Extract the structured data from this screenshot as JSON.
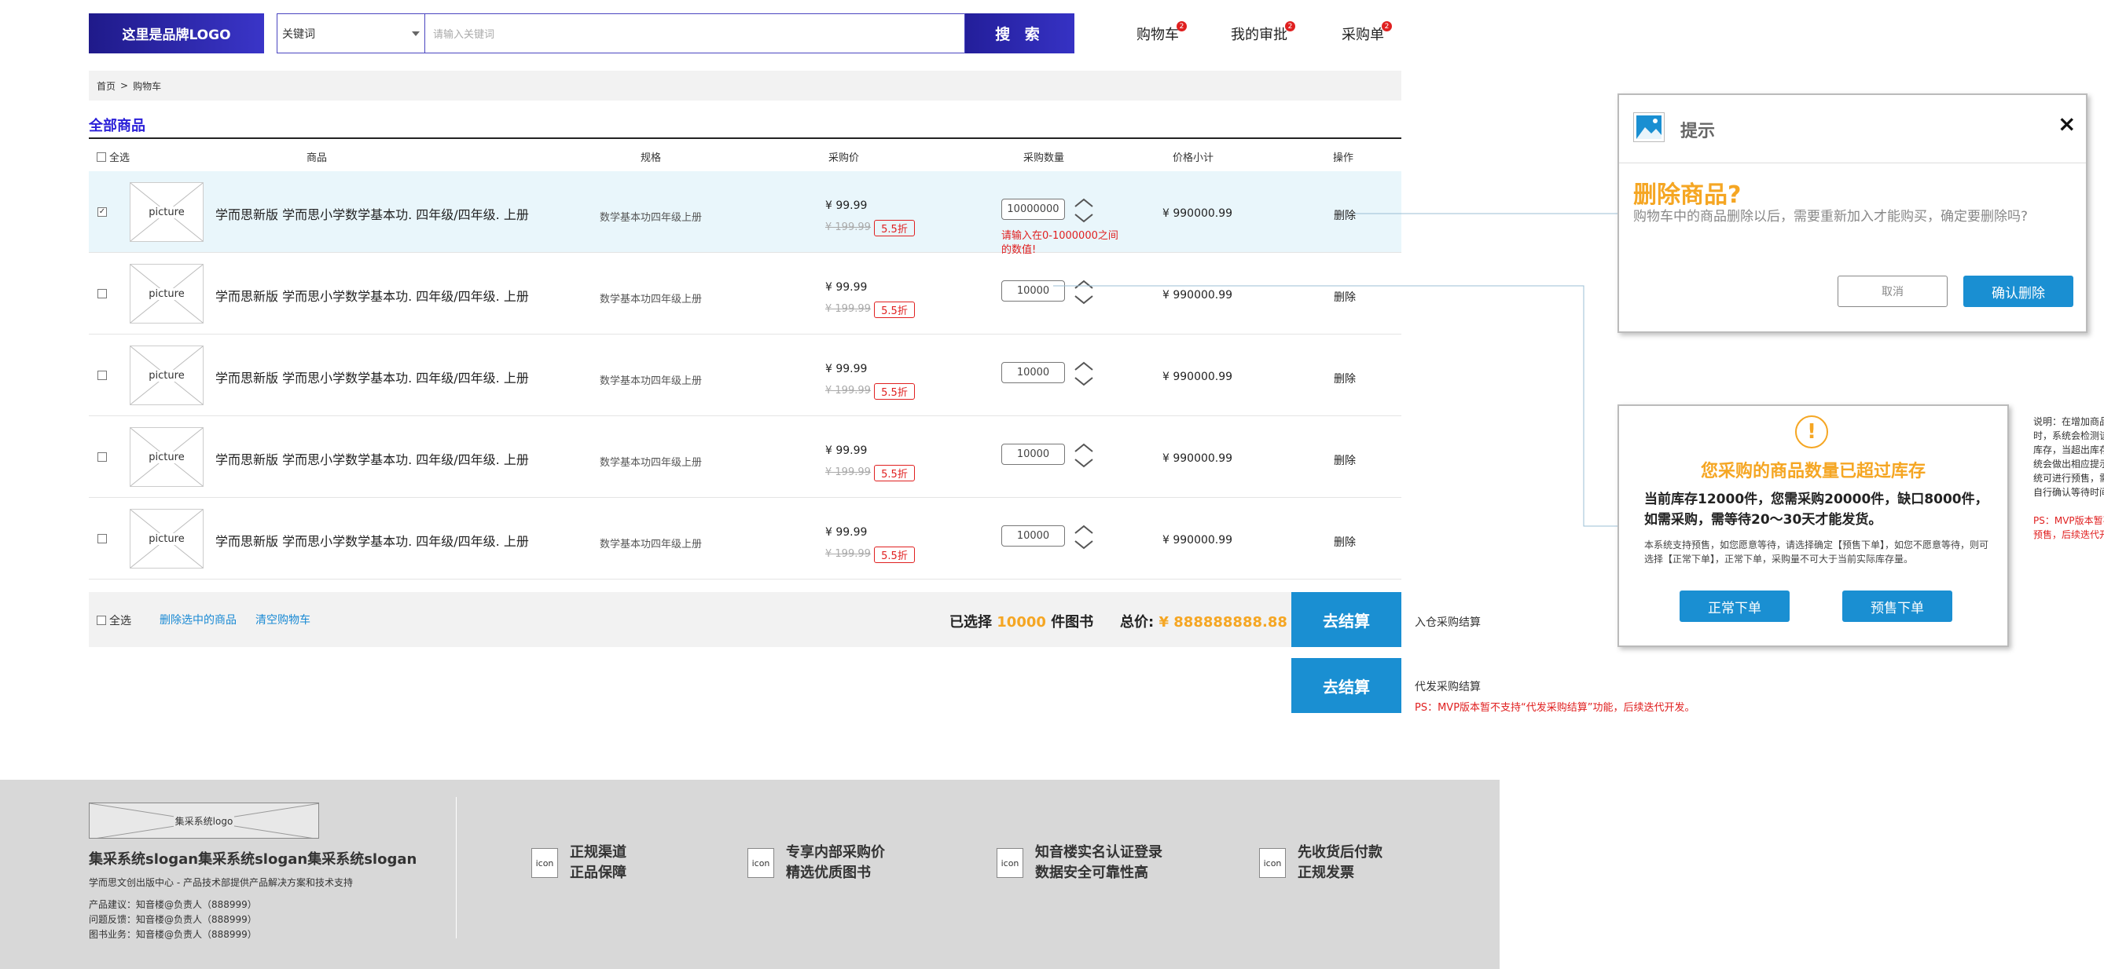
{
  "header": {
    "logo": "这里是品牌LOGO",
    "search_select": "关键词",
    "search_placeholder": "请输入关键词",
    "search_button": "搜 索",
    "nav": [
      {
        "label": "购物车",
        "badge": "2"
      },
      {
        "label": "我的审批",
        "badge": "2"
      },
      {
        "label": "采购单",
        "badge": "2"
      }
    ]
  },
  "breadcrumb": {
    "home": "首页",
    "sep": ">",
    "current": "购物车"
  },
  "section_title": "全部商品",
  "table": {
    "select_all": "全选",
    "columns": [
      "商品",
      "规格",
      "采购价",
      "采购数量",
      "价格小计",
      "操作"
    ],
    "picture_label": "picture",
    "rows": [
      {
        "name": "学而思新版 学而思小学数学基本功. 四年级/四年级. 上册",
        "spec": "数学基本功四年级上册",
        "price": "¥ 99.99",
        "old_price": "¥ 199.99",
        "discount": "5.5折",
        "qty": "10000000",
        "subtotal": "¥ 990000.99",
        "action": "删除",
        "checked": true,
        "error": "请输入在0-1000000之间的数值!"
      },
      {
        "name": "学而思新版 学而思小学数学基本功. 四年级/四年级. 上册",
        "spec": "数学基本功四年级上册",
        "price": "¥ 99.99",
        "old_price": "¥ 199.99",
        "discount": "5.5折",
        "qty": "10000",
        "subtotal": "¥ 990000.99",
        "action": "删除",
        "checked": false
      },
      {
        "name": "学而思新版 学而思小学数学基本功. 四年级/四年级. 上册",
        "spec": "数学基本功四年级上册",
        "price": "¥ 99.99",
        "old_price": "¥ 199.99",
        "discount": "5.5折",
        "qty": "10000",
        "subtotal": "¥ 990000.99",
        "action": "删除",
        "checked": false
      },
      {
        "name": "学而思新版 学而思小学数学基本功. 四年级/四年级. 上册",
        "spec": "数学基本功四年级上册",
        "price": "¥ 99.99",
        "old_price": "¥ 199.99",
        "discount": "5.5折",
        "qty": "10000",
        "subtotal": "¥ 990000.99",
        "action": "删除",
        "checked": false
      },
      {
        "name": "学而思新版 学而思小学数学基本功. 四年级/四年级. 上册",
        "spec": "数学基本功四年级上册",
        "price": "¥ 99.99",
        "old_price": "¥ 199.99",
        "discount": "5.5折",
        "qty": "10000",
        "subtotal": "¥ 990000.99",
        "action": "删除",
        "checked": false
      }
    ]
  },
  "cart_footer": {
    "select_all": "全选",
    "delete_selected": "删除选中的商品",
    "clear_cart": "清空购物车",
    "selected_prefix": "已选择",
    "selected_count": "10000",
    "selected_suffix": "件图书",
    "total_label": "总价:",
    "total_value": "¥ 888888888.88",
    "checkout_label": "去结算",
    "checkout_note": "入仓采购结算",
    "checkout2_label": "去结算",
    "checkout2_note": "代发采购结算",
    "checkout2_ps": "PS：MVP版本暂不支持“代发采购结算”功能，后续迭代开发。"
  },
  "delete_dialog": {
    "title": "提示",
    "close": "×",
    "heading": "删除商品?",
    "body": "购物车中的商品删除以后，需要重新加入才能购买，确定要删除吗?",
    "cancel": "取消",
    "confirm": "确认删除"
  },
  "stock_dialog": {
    "icon": "!",
    "heading": "您采购的商品数量已超过库存",
    "main": "当前库存12000件，您需采购20000件，缺口8000件，如需采购，需等待20～30天才能发货。",
    "detail": "本系统支持预售，如您愿意等待，请选择确定【预售下单】，如您不愿意等待，则可选择【正常下单】，正常下单，采购量不可大于当前实际库存量。",
    "normal": "正常下单",
    "presale": "预售下单"
  },
  "side_note": {
    "text": "说明：在增加商品数量时，系统会检测该商品的库存，当超出库存时，系统会做出相应提示。该系统可进行预售，需要客户自行确认等待时间。",
    "ps": "PS：MVP版本暂不支持预售，后续迭代开发。"
  },
  "site_footer": {
    "logo": "集采系统logo",
    "slogan": "集采系统slogan集采系统slogan集采系统slogan",
    "subtitle": "学而思文创出版中心 - 产品技术部提供产品解决方案和技术支持",
    "contacts": [
      "产品建议：知音楼@负责人（888999）",
      "问题反馈：知音楼@负责人（888999）",
      "图书业务：知音楼@负责人（888999）"
    ],
    "icon_label": "icon",
    "features": [
      {
        "line1": "正规渠道",
        "line2": "正品保障"
      },
      {
        "line1": "专享内部采购价",
        "line2": "精选优质图书"
      },
      {
        "line1": "知音楼实名认证登录",
        "line2": "数据安全可靠性高"
      },
      {
        "line1": "先收货后付款",
        "line2": "正规发票"
      }
    ]
  },
  "colors": {
    "brand": "#2a1fd8",
    "accent": "#1a8fd2",
    "warning": "#f5a623",
    "error": "#e02020"
  }
}
